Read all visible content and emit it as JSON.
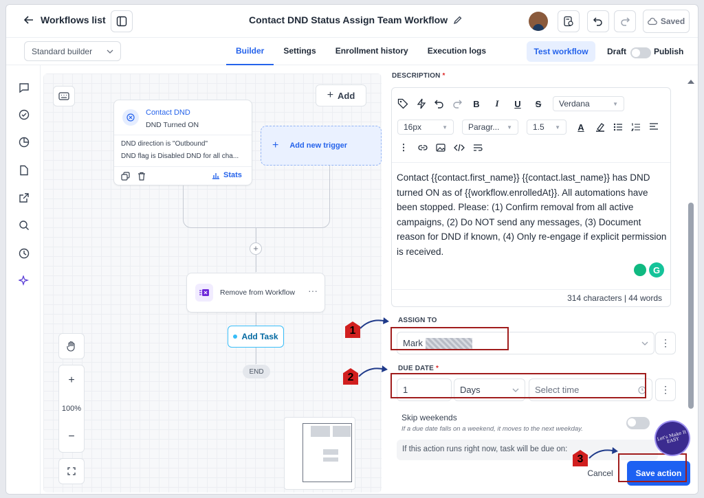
{
  "header": {
    "back_label": "Workflows list",
    "title": "Contact DND Status Assign Team Workflow",
    "saved_label": "Saved"
  },
  "subheader": {
    "builder_mode": "Standard builder",
    "tabs": [
      {
        "label": "Builder",
        "active": true
      },
      {
        "label": "Settings",
        "active": false
      },
      {
        "label": "Enrollment history",
        "active": false
      },
      {
        "label": "Execution logs",
        "active": false
      }
    ],
    "test_label": "Test workflow",
    "draft_label": "Draft",
    "publish_label": "Publish"
  },
  "canvas": {
    "add_label": "Add",
    "trigger": {
      "title": "Contact DND",
      "subtitle": "DND Turned ON",
      "line1": "DND direction is \"Outbound\"",
      "line2": "DND flag is Disabled DND for all cha...",
      "stats_label": "Stats"
    },
    "add_trigger_label": "Add new trigger",
    "action1_label": "Remove from Workflow",
    "action2_label": "Add Task",
    "end_label": "END",
    "zoom_label": "100%"
  },
  "panel": {
    "description_label": "DESCRIPTION",
    "font_family": "Verdana",
    "font_size": "16px",
    "paragraph": "Paragr...",
    "line_height": "1.5",
    "description_text": "Contact {{contact.first_name}} {{contact.last_name}} has DND turned ON as of {{workflow.enrolledAt}}. All automations have been stopped. Please: (1) Confirm removal from all active campaigns, (2) Do NOT send any messages, (3) Document reason for DND if known, (4) Only re-engage if explicit permission is received.",
    "char_count": "314 characters",
    "word_count": "44 words",
    "assign_label": "ASSIGN TO",
    "assign_value": "Mark",
    "due_label": "DUE DATE",
    "due_value": "1",
    "due_unit": "Days",
    "time_placeholder": "Select time",
    "skip_label": "Skip weekends",
    "skip_help": "If a due date falls on a weekend, it moves to the next weekday.",
    "due_preview": "If this action runs right now, task will be due on:",
    "cancel_label": "Cancel",
    "save_label": "Save action"
  },
  "annotations": [
    "1",
    "2",
    "3"
  ],
  "watermark": "Let's Make It EASY",
  "colors": {
    "accent": "#2563eb",
    "annotation_red": "#a01c1c",
    "save_button": "#1d61f2"
  }
}
